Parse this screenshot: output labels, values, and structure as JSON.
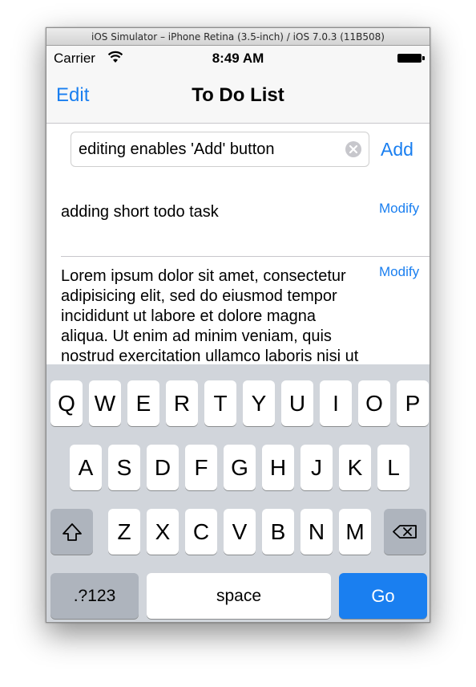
{
  "window": {
    "title": "iOS Simulator – iPhone Retina (3.5-inch) / iOS 7.0.3 (11B508)"
  },
  "status_bar": {
    "carrier": "Carrier",
    "time": "8:49 AM",
    "wifi_icon": "wifi-icon",
    "battery_icon": "battery-icon"
  },
  "nav": {
    "edit_label": "Edit",
    "title": "To Do List"
  },
  "new_item": {
    "value": "editing enables 'Add' button",
    "add_label": "Add",
    "clear_icon": "clear-circle-icon"
  },
  "todos": [
    {
      "text": "adding short todo task",
      "action": "Modify"
    },
    {
      "text": "Lorem ipsum dolor sit amet, consectetur adipisicing elit, sed do eiusmod tempor incididunt ut labore et dolore magna aliqua. Ut enim ad minim veniam, quis nostrud exercitation ullamco laboris nisi ut aliquip ex ea",
      "action": "Modify"
    }
  ],
  "keyboard": {
    "row1": [
      "Q",
      "W",
      "E",
      "R",
      "T",
      "Y",
      "U",
      "I",
      "O",
      "P"
    ],
    "row2": [
      "A",
      "S",
      "D",
      "F",
      "G",
      "H",
      "J",
      "K",
      "L"
    ],
    "row3": [
      "Z",
      "X",
      "C",
      "V",
      "B",
      "N",
      "M"
    ],
    "shift_icon": "shift-arrow-icon",
    "delete_icon": "delete-backspace-icon",
    "numbers_label": ".?123",
    "space_label": "space",
    "go_label": "Go"
  },
  "colors": {
    "accent": "#1a7ff0",
    "keyboard_bg": "#d1d5db",
    "dark_key": "#aeb4bd"
  }
}
